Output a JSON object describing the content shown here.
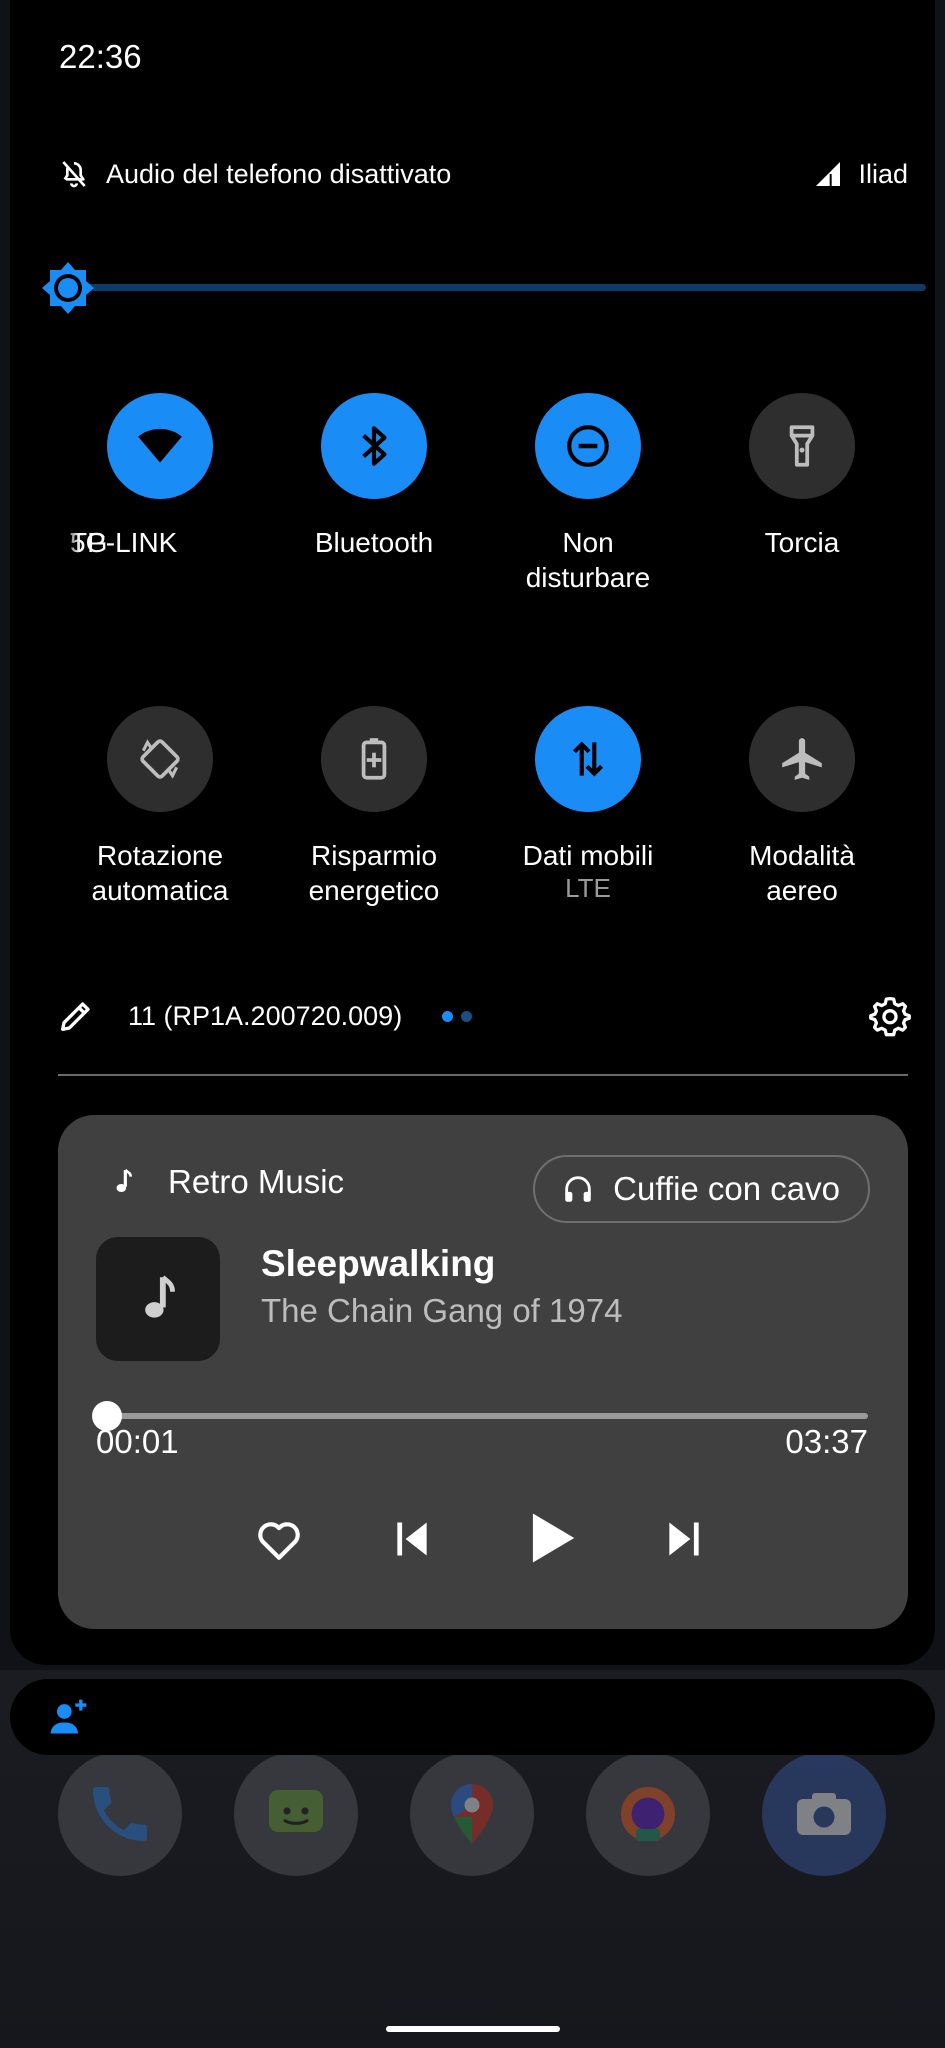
{
  "status_bar": {
    "time": "22:36"
  },
  "header": {
    "ringer_status": "Audio del telefono disattivato",
    "carrier": "Iliad"
  },
  "brightness": {
    "level": 0.0
  },
  "tiles": [
    {
      "label_a": "5G",
      "label_b": "TP-LINK",
      "state": "on",
      "icon": "wifi-icon"
    },
    {
      "label": "Bluetooth",
      "state": "on",
      "icon": "bluetooth-icon"
    },
    {
      "label": "Non\ndisturbare",
      "state": "on",
      "icon": "do-not-disturb-icon"
    },
    {
      "label": "Torcia",
      "state": "off",
      "icon": "flashlight-icon"
    },
    {
      "label": "Rotazione\nautomatica",
      "state": "off",
      "icon": "auto-rotate-icon"
    },
    {
      "label": "Risparmio\nenergetico",
      "state": "off",
      "icon": "battery-saver-icon"
    },
    {
      "label": "Dati mobili",
      "sublabel": "LTE",
      "state": "on",
      "icon": "mobile-data-icon"
    },
    {
      "label": "Modalità\naereo",
      "state": "off",
      "icon": "airplane-icon"
    }
  ],
  "footer": {
    "build": "11 (RP1A.200720.009)",
    "page_count": 2,
    "current_page": 1
  },
  "media": {
    "app_name": "Retro Music",
    "output_device": "Cuffie con cavo",
    "title": "Sleepwalking",
    "artist": "The Chain Gang of 1974",
    "elapsed": "00:01",
    "duration": "03:37",
    "progress": 0.005
  },
  "dock": {
    "apps": [
      "phone-app-icon",
      "messages-app-icon",
      "maps-app-icon",
      "firefox-beta-app-icon",
      "camera-app-icon"
    ],
    "firefox_badge": "BETA"
  },
  "colors": {
    "accent": "#1a8cf5",
    "tile_off": "#2e2e2e",
    "media_card": "#404040",
    "brightness_track": "#0d3a66"
  }
}
